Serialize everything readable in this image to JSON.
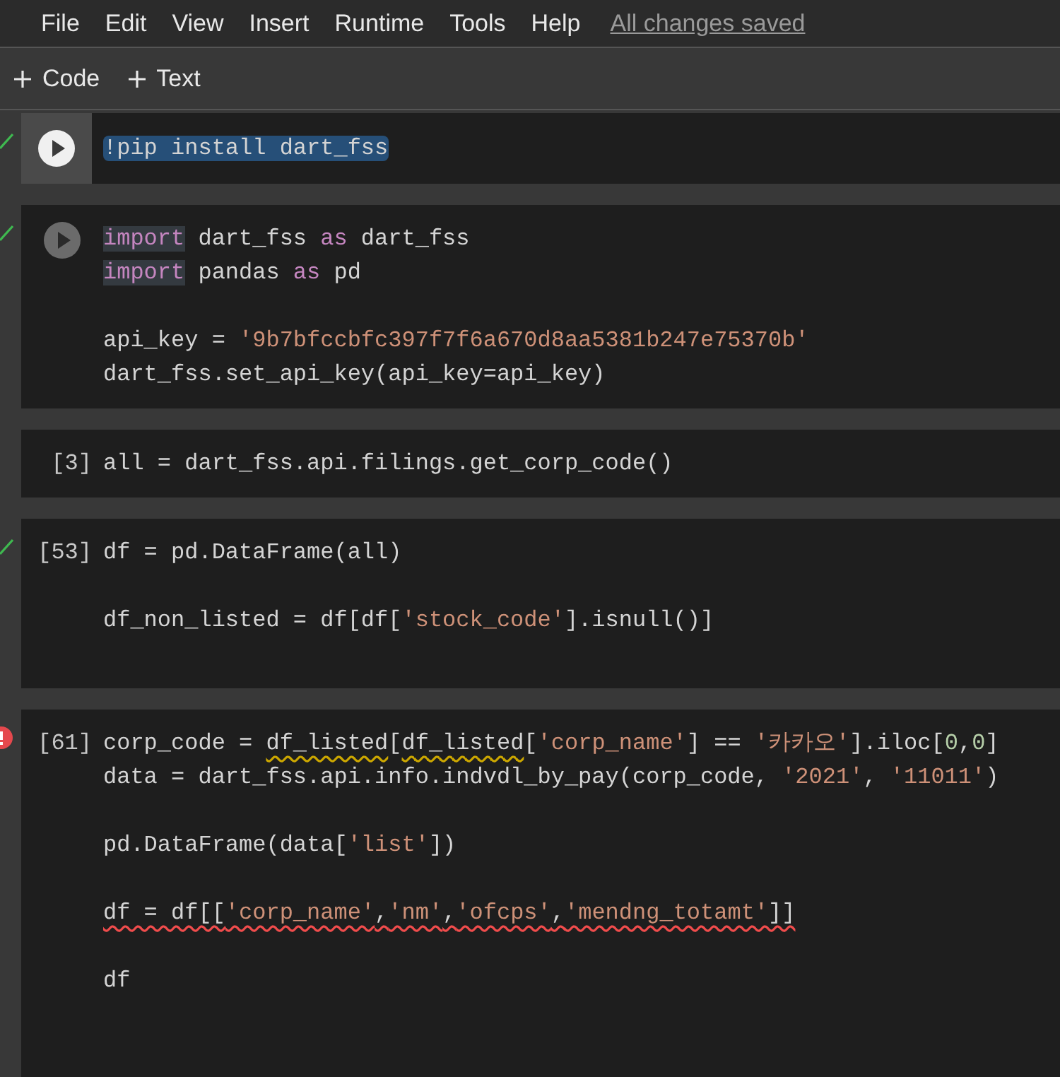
{
  "menu": [
    {
      "label": "File"
    },
    {
      "label": "Edit"
    },
    {
      "label": "View"
    },
    {
      "label": "Insert"
    },
    {
      "label": "Runtime"
    },
    {
      "label": "Tools"
    },
    {
      "label": "Help"
    }
  ],
  "save_status": "All changes saved",
  "toolbar": [
    {
      "label": "Code"
    },
    {
      "label": "Text"
    }
  ],
  "cells": [
    {
      "kind": "run_button",
      "succeeded": true,
      "selected": true,
      "lines": [
        {
          "kind": "code",
          "tokens": [
            {
              "text": "!pip install dart_fss",
              "kind": "plain",
              "selected": true
            }
          ]
        }
      ]
    },
    {
      "kind": "run_icon",
      "succeeded": true,
      "selected": false,
      "lines": [
        {
          "kind": "code",
          "tokens": [
            {
              "text": "import",
              "kind": "keyword",
              "highlighted": true
            },
            {
              "text": " dart_fss ",
              "kind": "plain"
            },
            {
              "text": "as",
              "kind": "keyword"
            },
            {
              "text": " dart_fss",
              "kind": "plain"
            }
          ]
        },
        {
          "kind": "code",
          "tokens": [
            {
              "text": "import",
              "kind": "keyword",
              "highlighted": true
            },
            {
              "text": " pandas ",
              "kind": "plain"
            },
            {
              "text": "as",
              "kind": "keyword"
            },
            {
              "text": " pd",
              "kind": "plain"
            }
          ]
        },
        {
          "kind": "blank"
        },
        {
          "kind": "code",
          "tokens": [
            {
              "text": "api_key = ",
              "kind": "plain"
            },
            {
              "text": "'9b7bfccbfc397f7f6a670d8aa5381b247e75370b'",
              "kind": "string"
            }
          ]
        },
        {
          "kind": "code",
          "tokens": [
            {
              "text": "dart_fss.set_api_key(api_key=api_key)",
              "kind": "plain"
            }
          ]
        }
      ]
    },
    {
      "kind": "count",
      "count": "[3]",
      "selected": false,
      "lines": [
        {
          "kind": "code",
          "tokens": [
            {
              "text": "all = dart_fss.api.filings.get_corp_code()",
              "kind": "plain"
            }
          ]
        }
      ]
    },
    {
      "kind": "count",
      "count": "[53]",
      "succeeded": true,
      "selected": false,
      "lines": [
        {
          "kind": "code",
          "tokens": [
            {
              "text": "df = pd.DataFrame(all)",
              "kind": "plain"
            }
          ]
        },
        {
          "kind": "blank"
        },
        {
          "kind": "code",
          "tokens": [
            {
              "text": "df_non_listed = df[df[",
              "kind": "plain"
            },
            {
              "text": "'stock_code'",
              "kind": "string"
            },
            {
              "text": "].isnull()]",
              "kind": "plain"
            }
          ]
        },
        {
          "kind": "blank"
        }
      ]
    },
    {
      "kind": "count",
      "count": "[61]",
      "failed": true,
      "selected": false,
      "lines": [
        {
          "kind": "code",
          "tokens": [
            {
              "text": "corp_code = ",
              "kind": "plain"
            },
            {
              "text": "df_listed",
              "kind": "plain",
              "warning": true
            },
            {
              "text": "[",
              "kind": "plain"
            },
            {
              "text": "df_listed",
              "kind": "plain",
              "warning": true
            },
            {
              "text": "[",
              "kind": "plain"
            },
            {
              "text": "'corp_name'",
              "kind": "string"
            },
            {
              "text": "] == ",
              "kind": "plain"
            },
            {
              "text": "'카카오'",
              "kind": "string"
            },
            {
              "text": "].iloc[",
              "kind": "plain"
            },
            {
              "text": "0",
              "kind": "number"
            },
            {
              "text": ",",
              "kind": "plain"
            },
            {
              "text": "0",
              "kind": "number"
            },
            {
              "text": "]",
              "kind": "plain"
            }
          ]
        },
        {
          "kind": "code",
          "tokens": [
            {
              "text": "data = dart_fss.api.info.indvdl_by_pay(corp_code, ",
              "kind": "plain"
            },
            {
              "text": "'2021'",
              "kind": "string"
            },
            {
              "text": ", ",
              "kind": "plain"
            },
            {
              "text": "'11011'",
              "kind": "string"
            },
            {
              "text": ")",
              "kind": "plain"
            }
          ]
        },
        {
          "kind": "blank"
        },
        {
          "kind": "code",
          "tokens": [
            {
              "text": "pd.DataFrame(data[",
              "kind": "plain"
            },
            {
              "text": "'list'",
              "kind": "string"
            },
            {
              "text": "])",
              "kind": "plain"
            }
          ]
        },
        {
          "kind": "blank"
        },
        {
          "kind": "code",
          "tokens": [
            {
              "text": "df = df[[",
              "kind": "plain",
              "error": true
            },
            {
              "text": "'corp_name'",
              "kind": "string",
              "error": true
            },
            {
              "text": ",",
              "kind": "plain",
              "error": true
            },
            {
              "text": "'nm'",
              "kind": "string",
              "error": true
            },
            {
              "text": ",",
              "kind": "plain",
              "error": true
            },
            {
              "text": "'ofcps'",
              "kind": "string",
              "error": true
            },
            {
              "text": ",",
              "kind": "plain",
              "error": true
            },
            {
              "text": "'mendng_totamt'",
              "kind": "string",
              "error": true
            },
            {
              "text": "]]",
              "kind": "plain",
              "error": true
            }
          ]
        },
        {
          "kind": "blank"
        },
        {
          "kind": "code",
          "tokens": [
            {
              "text": "df",
              "kind": "plain"
            }
          ]
        }
      ]
    }
  ]
}
